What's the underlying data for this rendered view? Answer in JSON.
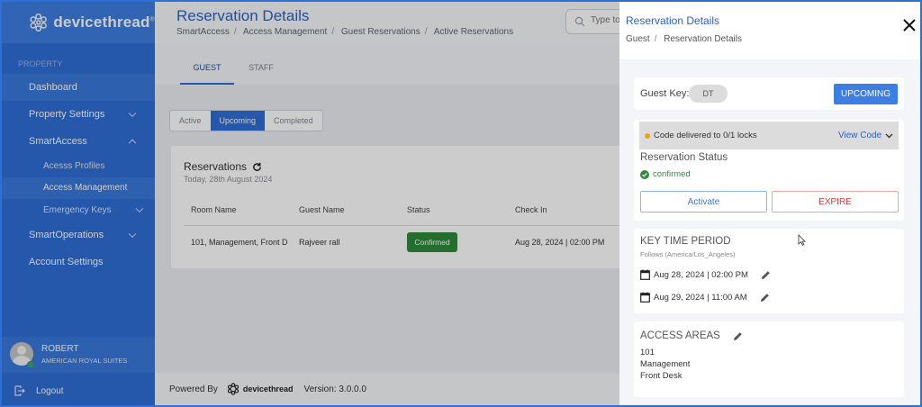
{
  "brand": {
    "name": "devicethread",
    "reg": "®"
  },
  "sidebar": {
    "section_label": "PROPERTY",
    "items": [
      {
        "label": "Dashboard"
      },
      {
        "label": "Property Settings"
      },
      {
        "label": "SmartAccess"
      },
      {
        "label": "Acesss Profiles"
      },
      {
        "label": "Access Management"
      },
      {
        "label": "Emergency Keys"
      },
      {
        "label": "SmartOperations"
      },
      {
        "label": "Account Settings"
      }
    ],
    "user": {
      "name": "ROBERT",
      "org": "AMERICAN ROYAL SUITES"
    },
    "logout_label": "Logout"
  },
  "main": {
    "title": "Reservation Details",
    "breadcrumb": [
      "SmartAccess",
      "Access Management",
      "Guest Reservations",
      "Active Reservations"
    ],
    "search_placeholder": "Type to search",
    "tabs": [
      "GUEST",
      "STAFF"
    ],
    "filters": [
      "Active",
      "Upcoming",
      "Completed"
    ],
    "reservations": {
      "title": "Reservations",
      "date": "Today, 28th August 2024",
      "columns": [
        "Room Name",
        "Guest Name",
        "Status",
        "Check In"
      ],
      "rows": [
        {
          "room": "101,  Management,  Front D",
          "guest": "Rajveer rall",
          "status": "Confirmed",
          "check_in": "Aug 28, 2024 | 02:00 PM"
        }
      ]
    },
    "footer": {
      "powered_by": "Powered By",
      "brand": "devicethread",
      "version": "Version: 3.0.0.0"
    }
  },
  "drawer": {
    "title": "Reservation Details",
    "breadcrumb": [
      "Guest",
      "Reservation Details"
    ],
    "guest_key_label": "Guest Key:",
    "guest_key_chip": "DT",
    "upcoming_label": "UPCOMING",
    "code_status": "Code delivered to 0/1 locks",
    "view_code": "View Code",
    "reservation_status_title": "Reservation Status",
    "reservation_status": "confirmed",
    "activate_label": "Activate",
    "expire_label": "EXPIRE",
    "key_time_title": "KEY TIME PERIOD",
    "timezone_note": "Follows (America/Los_Angeles)",
    "start": "Aug 28, 2024 | 02:00 PM",
    "end": "Aug 29, 2024 | 11:00 AM",
    "access_areas_title": "ACCESS AREAS",
    "access_areas": [
      "101",
      "Management",
      "Front Desk"
    ]
  },
  "colors": {
    "accent": "#2f6fd6",
    "success": "#2f8b3a",
    "danger": "#d83a3a",
    "warning": "#f1a20b"
  }
}
